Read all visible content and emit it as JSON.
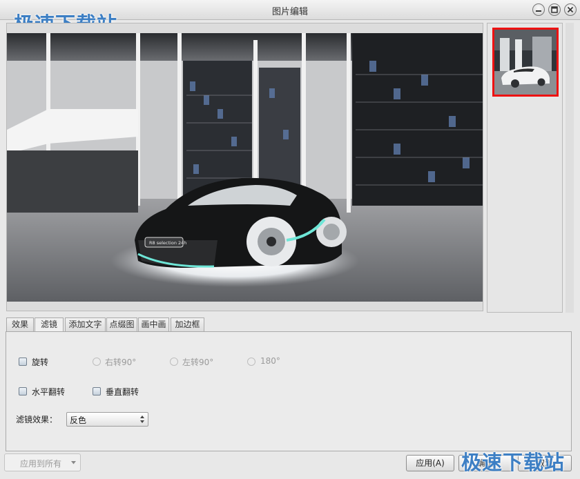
{
  "window": {
    "title": "图片编辑"
  },
  "watermark": {
    "text": "极速下载站"
  },
  "photo": {
    "badge_text": "R8 selection 24h"
  },
  "tabs": [
    {
      "label": "效果"
    },
    {
      "label": "滤镜"
    },
    {
      "label": "添加文字"
    },
    {
      "label": "点缀图"
    },
    {
      "label": "画中画"
    },
    {
      "label": "加边框"
    }
  ],
  "panel": {
    "rotate_label": "旋转",
    "rotate_options": [
      "右转90°",
      "左转90°",
      "180°"
    ],
    "flip_horizontal_label": "水平翻转",
    "flip_vertical_label": "垂直翻转",
    "filter_label": "滤镜效果：",
    "filter_value": "反色"
  },
  "footer": {
    "apply_all_label": "应用到所有",
    "apply_label": "应用(A)",
    "ok_label": "确定",
    "cancel_label": "取消"
  },
  "colors": {
    "thumb_selected_border": "#e11111",
    "watermark": "#3d7fc4"
  }
}
